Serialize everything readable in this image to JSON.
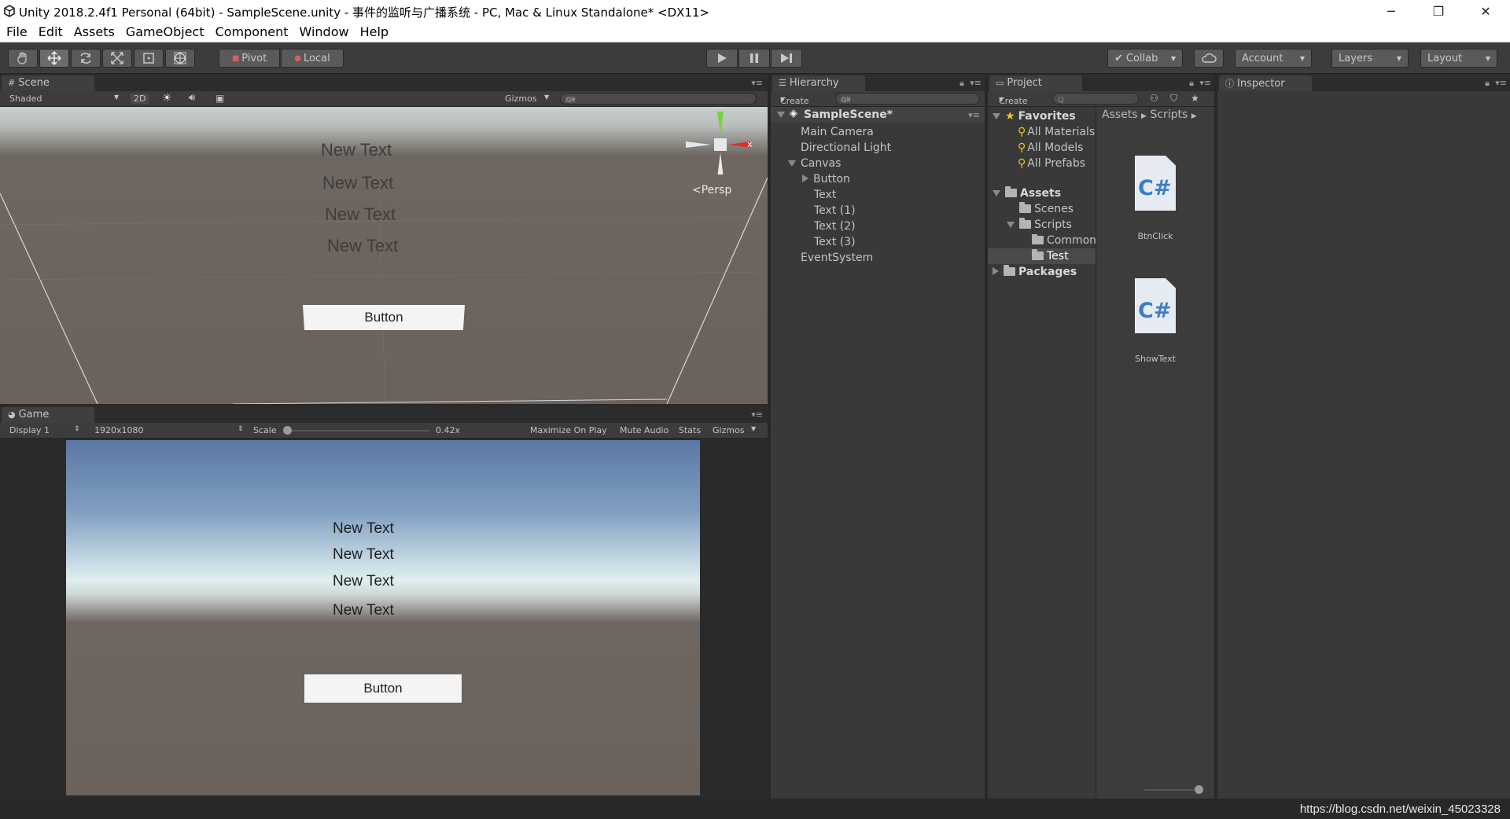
{
  "window": {
    "title": "Unity 2018.2.4f1 Personal (64bit) - SampleScene.unity - 事件的监听与广播系统 - PC, Mac & Linux Standalone* <DX11>",
    "minimize_icon": "─",
    "restore_icon": "❐",
    "close_icon": "✕"
  },
  "menu": [
    "File",
    "Edit",
    "Assets",
    "GameObject",
    "Component",
    "Window",
    "Help"
  ],
  "toolbar": {
    "pivot_label": "Pivot",
    "local_label": "Local",
    "collab_label": "Collab",
    "account_label": "Account",
    "layers_label": "Layers",
    "layout_label": "Layout"
  },
  "scene": {
    "tab_label": "Scene",
    "shading_mode": "Shaded",
    "mode_2d": "2D",
    "gizmos_label": "Gizmos",
    "search_placeholder": "All",
    "persp_label": "Persp",
    "axis_x_label": "x",
    "texts": [
      "New Text",
      "New Text",
      "New Text",
      "New Text"
    ],
    "button_label": "Button"
  },
  "game": {
    "tab_label": "Game",
    "display": "Display 1",
    "resolution": "1920x1080",
    "scale_label": "Scale",
    "scale_value": "0.42x",
    "maximize_on_play": "Maximize On Play",
    "mute_audio": "Mute Audio",
    "stats": "Stats",
    "gizmos_label": "Gizmos",
    "texts": [
      "New Text",
      "New Text",
      "New Text",
      "New Text"
    ],
    "button_label": "Button"
  },
  "hierarchy": {
    "tab_label": "Hierarchy",
    "create_label": "Create",
    "search_placeholder": "All",
    "scene_name": "SampleScene*",
    "items": [
      "Main Camera",
      "Directional Light",
      "Canvas",
      "Button",
      "Text",
      "Text (1)",
      "Text (2)",
      "Text (3)",
      "EventSystem"
    ]
  },
  "project": {
    "tab_label": "Project",
    "create_label": "Create",
    "favorites_label": "Favorites",
    "favorites": [
      "All Materials",
      "All Models",
      "All Prefabs"
    ],
    "assets_label": "Assets",
    "folders": [
      "Scenes",
      "Scripts",
      "Common",
      "Test"
    ],
    "packages_label": "Packages",
    "breadcrumb": [
      "Assets",
      "Scripts"
    ],
    "files": [
      {
        "name": "BtnClick",
        "type": "C#"
      },
      {
        "name": "ShowText",
        "type": "C#"
      }
    ]
  },
  "inspector": {
    "tab_label": "Inspector"
  },
  "watermark": "https://blog.csdn.net/weixin_45023328",
  "colors": {
    "editor_bg": "#3a3a3a",
    "scene_ground": "#6b625c",
    "game_sky": "#5f7aa6",
    "axis_y": "#7ccf3e",
    "axis_x": "#d8322c",
    "cs_blue": "#3c7ec9",
    "favorite_star": "#f5c518"
  }
}
